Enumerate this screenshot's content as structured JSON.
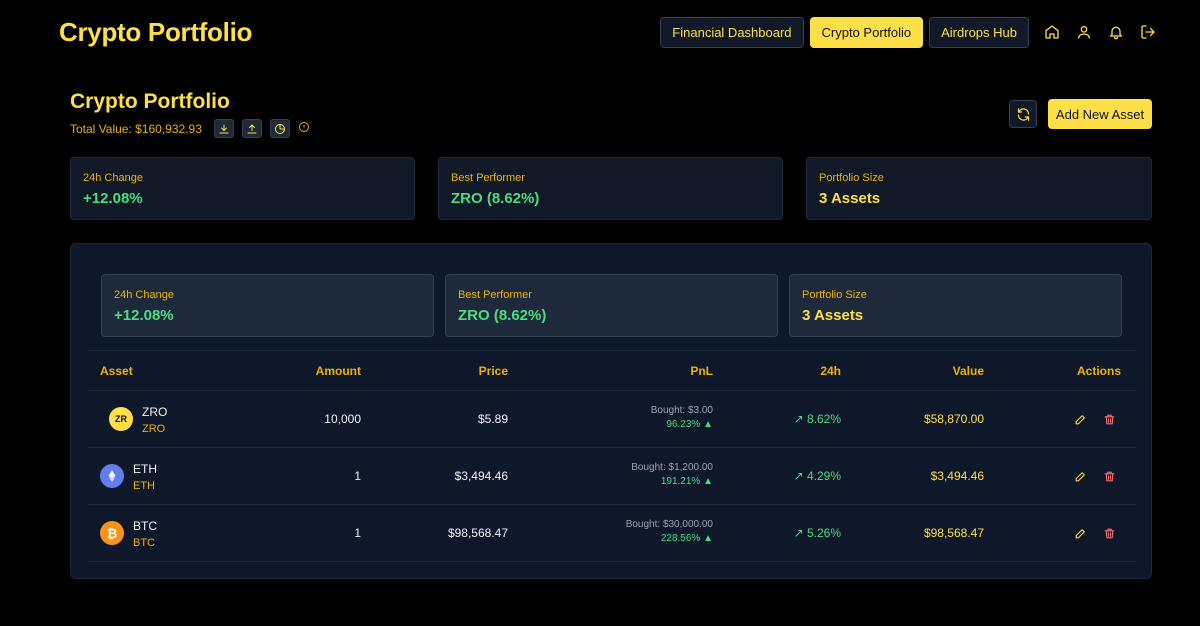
{
  "app": {
    "title": "Crypto Portfolio"
  },
  "nav": {
    "items": [
      {
        "label": "Financial Dashboard",
        "active": false
      },
      {
        "label": "Crypto Portfolio",
        "active": true
      },
      {
        "label": "Airdrops Hub",
        "active": false
      }
    ],
    "icons": [
      "home-icon",
      "user-icon",
      "bell-icon",
      "logout-icon"
    ]
  },
  "header": {
    "title": "Crypto Portfolio",
    "total_value": "Total Value: $160,932.93",
    "add_button": "Add New Asset"
  },
  "stats": [
    {
      "label": "24h Change",
      "value": "+12.08%",
      "color": "#4ade80"
    },
    {
      "label": "Best Performer",
      "value": "ZRO (8.62%)",
      "color": "#4ade80"
    },
    {
      "label": "Portfolio Size",
      "value": "3 Assets",
      "color": "#fde047"
    }
  ],
  "table": {
    "columns": [
      "Asset",
      "Amount",
      "Price",
      "PnL",
      "24h",
      "Value",
      "Actions"
    ],
    "rows": [
      {
        "name": "ZRO",
        "symbol": "ZRO",
        "icon_text": "ZR",
        "icon_color": "#fde047",
        "amount": "10,000",
        "price": "$5.89",
        "bought": "Bought: $3.00",
        "pnl": "96.23% ▲",
        "change": "8.62%",
        "value": "$58,870.00"
      },
      {
        "name": "ETH",
        "symbol": "ETH",
        "icon_text": "",
        "icon_color": "#627eea",
        "amount": "1",
        "price": "$3,494.46",
        "bought": "Bought: $1,200.00",
        "pnl": "191.21% ▲",
        "change": "4.29%",
        "value": "$3,494.46"
      },
      {
        "name": "BTC",
        "symbol": "BTC",
        "icon_text": "₿",
        "icon_color": "#f7931a",
        "amount": "1",
        "price": "$98,568.47",
        "bought": "Bought: $30,000.00",
        "pnl": "228.56% ▲",
        "change": "5.26%",
        "value": "$98,568.47"
      }
    ]
  }
}
